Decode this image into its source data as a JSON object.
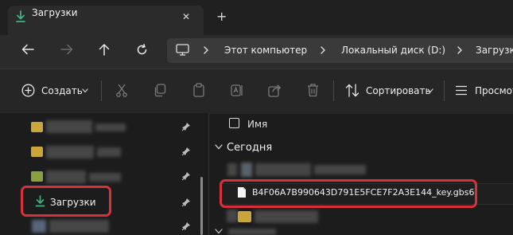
{
  "window": {
    "tab_title": "Загрузки",
    "close_glyph": "✕",
    "new_tab_glyph": "+"
  },
  "breadcrumbs": [
    "Этот компьютер",
    "Локальный диск (D:)",
    "Загрузки"
  ],
  "toolbar": {
    "create_label": "Создать",
    "sort_label": "Сортировать",
    "view_label": "Просмотр"
  },
  "sidebar": {
    "downloads_label": "Загрузки"
  },
  "file_list": {
    "name_header": "Имя",
    "group_today": "Сегодня",
    "highlighted_file": "B4F06A7B990643D791E5FCE7F2A3E144_key.gbs6"
  },
  "colors": {
    "accent_green": "#3fb27f",
    "highlight_red": "#d9303a",
    "folder_yellow": "#c9a53a"
  }
}
